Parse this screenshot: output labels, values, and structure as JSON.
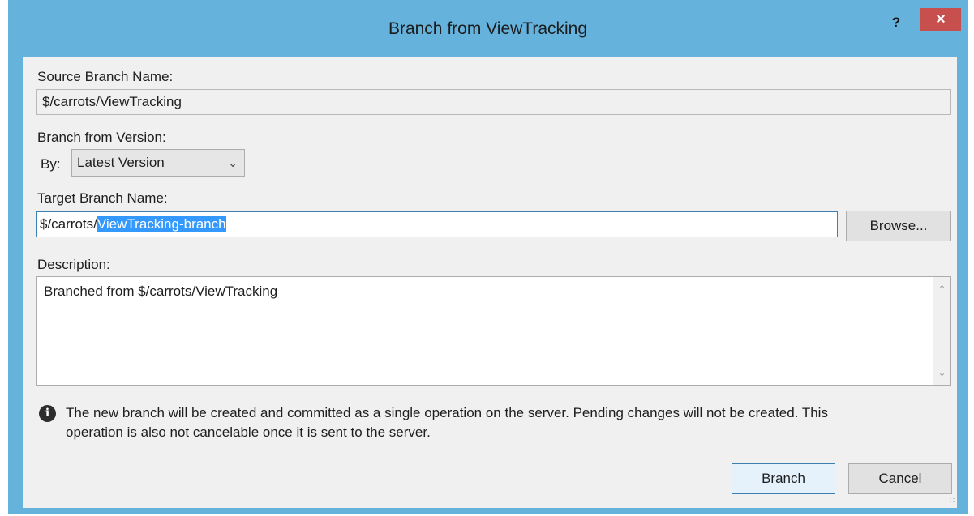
{
  "window": {
    "title": "Branch from ViewTracking",
    "help_label": "?",
    "close_label": "×"
  },
  "form": {
    "source_label": "Source Branch Name:",
    "source_value": "$/carrots/ViewTracking",
    "version_label": "Branch from Version:",
    "by_label": "By:",
    "version_selected": "Latest Version",
    "target_label": "Target Branch Name:",
    "target_prefix": "$/carrots/",
    "target_selected": "ViewTracking-branch",
    "browse_label": "Browse...",
    "description_label": "Description:",
    "description_value": "Branched from $/carrots/ViewTracking"
  },
  "info": {
    "icon": "info-icon",
    "line1": "The new branch will be created and committed as a single operation on the server. Pending changes will not be created. This",
    "line2": "operation is also not cancelable once it is sent to the server."
  },
  "buttons": {
    "branch_label": "Branch",
    "cancel_label": "Cancel"
  },
  "colors": {
    "title_bar": "#65b2dd",
    "close_button": "#c7504f",
    "selection": "#3399ff"
  }
}
